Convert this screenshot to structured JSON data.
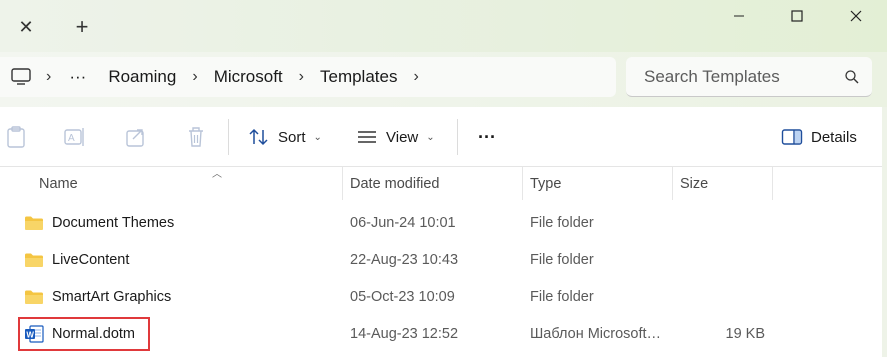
{
  "window": {
    "tab_close_symbol": "✕",
    "tab_new_symbol": "+",
    "controls": [
      "minimize-icon",
      "maximize-icon",
      "close-icon"
    ]
  },
  "address": {
    "crumbs": [
      "Roaming",
      "Microsoft",
      "Templates"
    ],
    "ellipsis": "···",
    "search_placeholder": "Search Templates"
  },
  "toolbar": {
    "sort_label": "Sort",
    "view_label": "View",
    "more_label": "···",
    "details_label": "Details"
  },
  "columns": {
    "name": "Name",
    "date_modified": "Date modified",
    "type": "Type",
    "size": "Size"
  },
  "files": [
    {
      "name": "Document Themes",
      "date": "06-Jun-24 10:01",
      "type": "File folder",
      "size": "",
      "icon": "folder-icon"
    },
    {
      "name": "LiveContent",
      "date": "22-Aug-23 10:43",
      "type": "File folder",
      "size": "",
      "icon": "folder-icon"
    },
    {
      "name": "SmartArt Graphics",
      "date": "05-Oct-23 10:09",
      "type": "File folder",
      "size": "",
      "icon": "folder-icon"
    },
    {
      "name": "Normal.dotm",
      "date": "14-Aug-23 12:52",
      "type": "Шаблон Microsoft…",
      "size": "19 KB",
      "icon": "word-document-icon"
    }
  ],
  "colors": {
    "highlight": "#e0393b",
    "folder": "#f4c542",
    "word_blue": "#185abd"
  }
}
